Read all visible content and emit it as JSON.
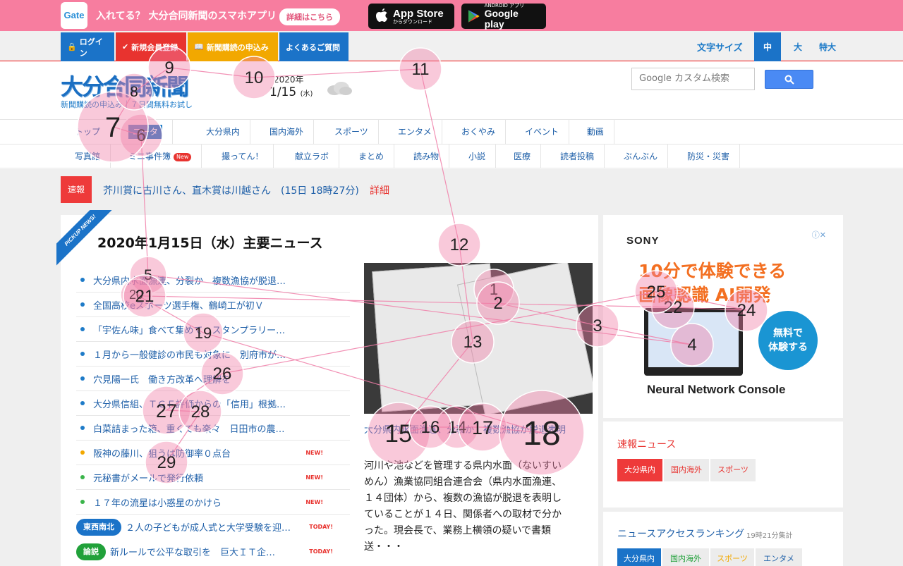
{
  "banner": {
    "logo": "Gate",
    "text": "入れてる？ 大分合同新聞のスマホアプリ",
    "detail_button": "詳細はこちら",
    "appstore_small": "",
    "appstore_big": "App Store",
    "appstore_sub": "からダウンロード",
    "googleplay_small": "ANDROID アプリ",
    "googleplay_big": "Google play"
  },
  "utility": {
    "login": "ログイン",
    "register": "新規会員登録",
    "subscribe": "新聞購読の申込み",
    "faq": "よくあるご質問",
    "fontsize_label": "文字サイズ",
    "fs_medium": "中",
    "fs_large": "大",
    "fs_xlarge": "特大"
  },
  "masthead": {
    "logo": "大分合同新聞",
    "tagline": "新聞購読の申込み｜７日間無料お試し",
    "date_year": "2020年",
    "date_md": "1/15",
    "date_weekday": "(水)",
    "search_placeholder": "Google カスタム検索"
  },
  "nav1": [
    "トップ",
    "ニータ",
    "大分県内",
    "国内海外",
    "スポーツ",
    "エンタメ",
    "おくやみ",
    "イベント",
    "動画"
  ],
  "nav2": [
    "写真館",
    "ミニ事件簿",
    "撮ってん！",
    "献立ラボ",
    "まとめ",
    "読み物",
    "小説",
    "医療",
    "読者投稿",
    "ぶんぶん",
    "防災・災害"
  ],
  "nav2_badge": "New",
  "breaking": {
    "tag": "速報",
    "text": "芥川賞に古川さん、直木賞は川越さん　(15日 18時27分)",
    "detail": "詳細"
  },
  "main": {
    "ribbon": "PICKUP NEWS!",
    "title": "2020年1月15日（水）主要ニュース",
    "news": [
      {
        "text": "大分県内水面漁連、分裂か　複数漁協が脱退…",
        "dot": "blue",
        "tag": ""
      },
      {
        "text": "全国高校eスポーツ選手権、鶴崎工が初Ｖ",
        "dot": "blue",
        "tag": ""
      },
      {
        "text": "「宇佐ん味」食べて集めて　スタンプラリー…",
        "dot": "blue",
        "tag": ""
      },
      {
        "text": "１月から一般健診の市民も対象に　別府市が…",
        "dot": "blue",
        "tag": ""
      },
      {
        "text": "穴見陽一氏　働き方改革へ理解を",
        "dot": "blue",
        "tag": ""
      },
      {
        "text": "大分県信組、ＴＧＦ評価からの「信用」根拠…",
        "dot": "blue",
        "tag": ""
      },
      {
        "text": "白菜詰まった箱、重くても楽々　日田市の農…",
        "dot": "blue",
        "tag": ""
      },
      {
        "text": "阪神の藤川、狙うは防御率０点台",
        "dot": "orange",
        "tag": "NEW!"
      },
      {
        "text": "元秘書がメールで発行依頼",
        "dot": "green",
        "tag": "NEW!"
      },
      {
        "text": "１７年の流星は小惑星のかけら",
        "dot": "green",
        "tag": "NEW!"
      }
    ],
    "cat_news": [
      {
        "category": "東西南北",
        "color": "#1b73c8",
        "text": "２人の子どもが成人式と大学受験を迎…",
        "tag": "TODAY!"
      },
      {
        "category": "論説",
        "color": "#21a13a",
        "text": "新ルールで公平な取引を　巨大ＩＴ企…",
        "tag": "TODAY!"
      }
    ],
    "caption": "大分県内水面漁連、分裂か　複数漁協が脱退表明",
    "body": "河川や池などを管理する県内水面（ないすいめん）漁業協同組合連合会（県内水面漁連、１４団体）から、複数の漁協が脱退を表明していることが１４日、関係者への取材で分かった。現会長で、業務上横領の疑いで書類送・・・"
  },
  "ad": {
    "brand": "SONY",
    "line1": "10分で体験できる",
    "line2": "画像認識 AI開発",
    "cta": "無料で\n体験する",
    "product": "Neural Network Console"
  },
  "sidebar": {
    "breaking_title": "速報ニュース",
    "breaking_tabs": [
      "大分県内",
      "国内海外",
      "スポーツ"
    ],
    "ranking_title": "ニュースアクセスランキング",
    "ranking_note": "19時21分集計",
    "ranking_tabs": [
      "大分県内",
      "国内海外",
      "スポーツ",
      "エンタメ"
    ]
  },
  "overlay_markers": [
    "1",
    "2",
    "3",
    "4",
    "5",
    "6",
    "7",
    "8",
    "9",
    "10",
    "11",
    "12",
    "13",
    "14",
    "15",
    "16",
    "17",
    "18",
    "19",
    "20",
    "21",
    "22",
    "24",
    "25",
    "26",
    "27",
    "28",
    "29"
  ],
  "colors": {
    "banner": "#f77d9f",
    "accent_red": "#ee3a3a",
    "accent_blue": "#1b73c8",
    "marker": "#f07ea8"
  }
}
